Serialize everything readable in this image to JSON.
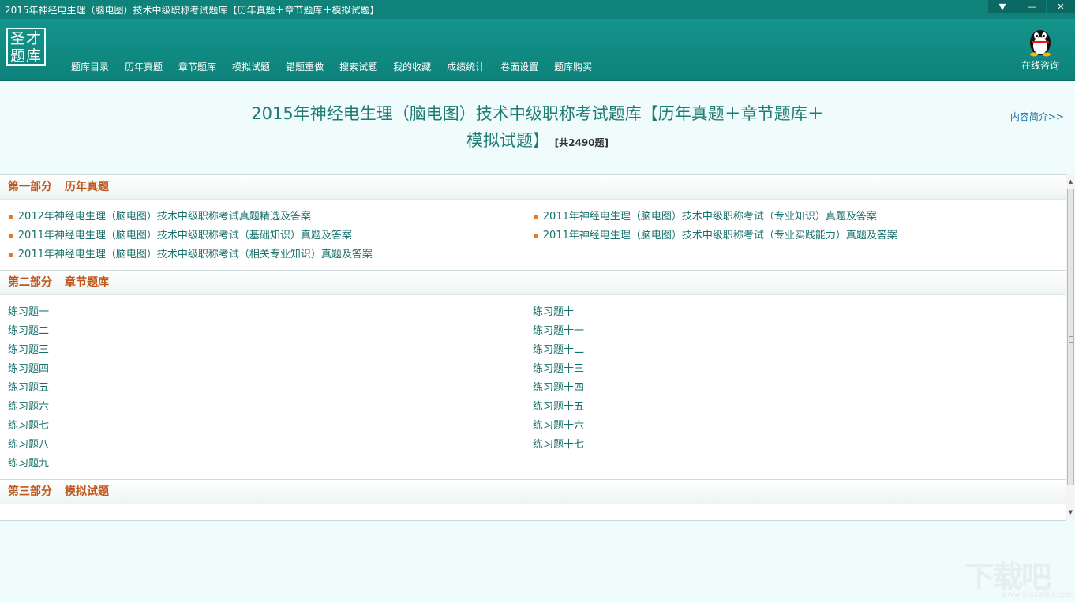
{
  "window": {
    "title": "2015年神经电生理（脑电图）技术中级职称考试题库【历年真题＋章节题库＋模拟试题】",
    "buttons": {
      "menu": "▼",
      "minimize": "—",
      "close": "✕"
    }
  },
  "header": {
    "logo_line1": "圣才",
    "logo_line2": "题库",
    "nav": [
      "题库目录",
      "历年真题",
      "章节题库",
      "模拟试题",
      "错题重做",
      "搜索试题",
      "我的收藏",
      "成绩统计",
      "卷面设置",
      "题库购买"
    ],
    "consult_label": "在线咨询"
  },
  "page": {
    "title_line1": "2015年神经电生理（脑电图）技术中级职称考试题库【历年真题＋章节题库＋",
    "title_line2": "模拟试题】",
    "count": "[共2490题]",
    "intro_link": "内容简介>>"
  },
  "sections": [
    {
      "part": "第一部分",
      "name": "历年真题",
      "left": [
        "2012年神经电生理（脑电图）技术中级职称考试真题精选及答案",
        "2011年神经电生理（脑电图）技术中级职称考试（基础知识）真题及答案",
        "2011年神经电生理（脑电图）技术中级职称考试（相关专业知识）真题及答案"
      ],
      "right": [
        "2011年神经电生理（脑电图）技术中级职称考试（专业知识）真题及答案",
        "2011年神经电生理（脑电图）技术中级职称考试（专业实践能力）真题及答案"
      ]
    },
    {
      "part": "第二部分",
      "name": "章节题库",
      "left": [
        "练习题一",
        "练习题二",
        "练习题三",
        "练习题四",
        "练习题五",
        "练习题六",
        "练习题七",
        "练习题八",
        "练习题九"
      ],
      "right": [
        "练习题十",
        "练习题十一",
        "练习题十二",
        "练习题十三",
        "练习题十四",
        "练习题十五",
        "练习题十六",
        "练习题十七"
      ]
    },
    {
      "part": "第三部分",
      "name": "模拟试题"
    }
  ],
  "watermark": {
    "main": "下载吧",
    "sub": "www.xiazaiba.com"
  },
  "colors": {
    "header": "#0f827a",
    "section_title": "#c0561b",
    "link": "#17706b",
    "bullet": "#e07a2a"
  }
}
